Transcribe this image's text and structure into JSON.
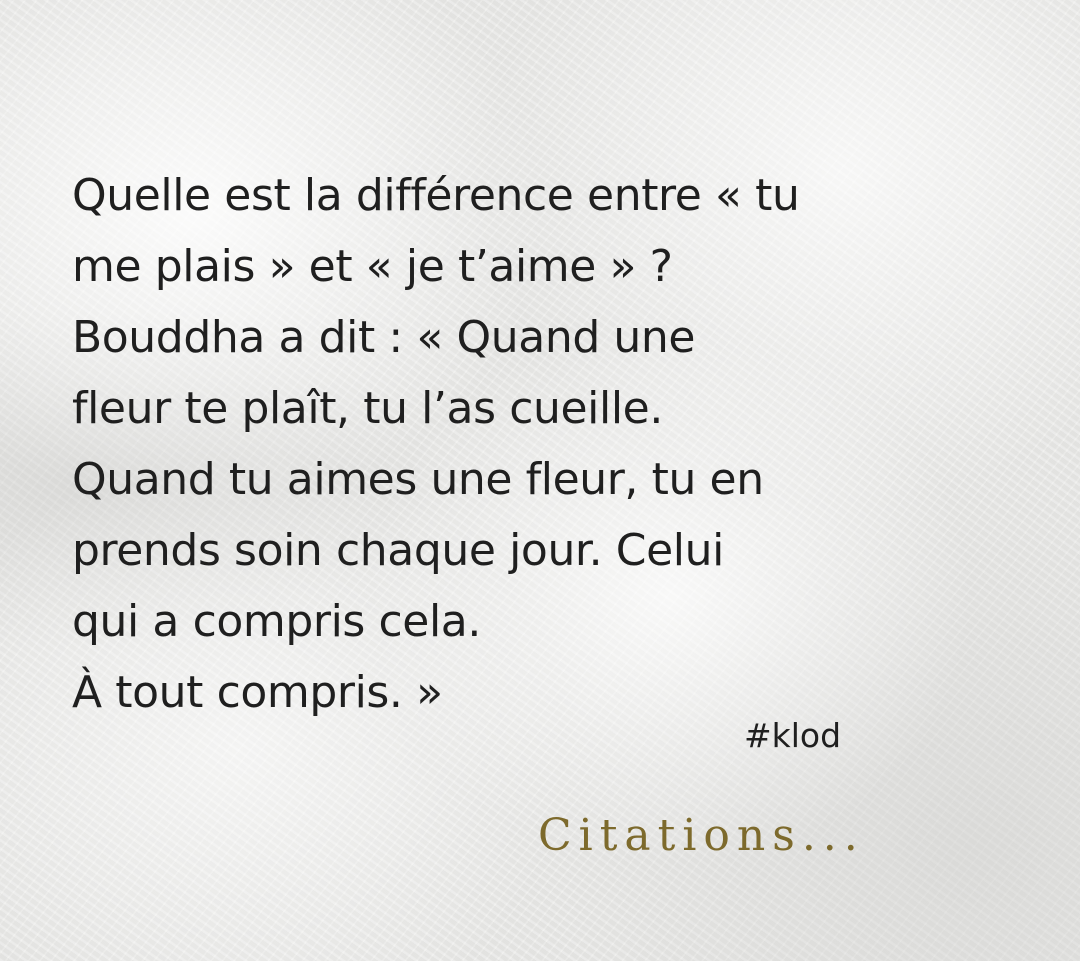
{
  "quote": {
    "lines": [
      "Quelle est la différence entre « tu",
      "me plais » et « je t’aime » ?",
      "Bouddha a dit : « Quand une",
      "fleur te plaît, tu l’as cueille.",
      "Quand tu aimes une fleur, tu en",
      "prends soin chaque jour. Celui",
      "qui a compris cela.",
      "À tout compris. »"
    ]
  },
  "hashtag": "#klod",
  "brand": "Citations...",
  "colors": {
    "background": "#ececea",
    "text": "#1f1f1f",
    "brand": "#7d6a2c"
  }
}
